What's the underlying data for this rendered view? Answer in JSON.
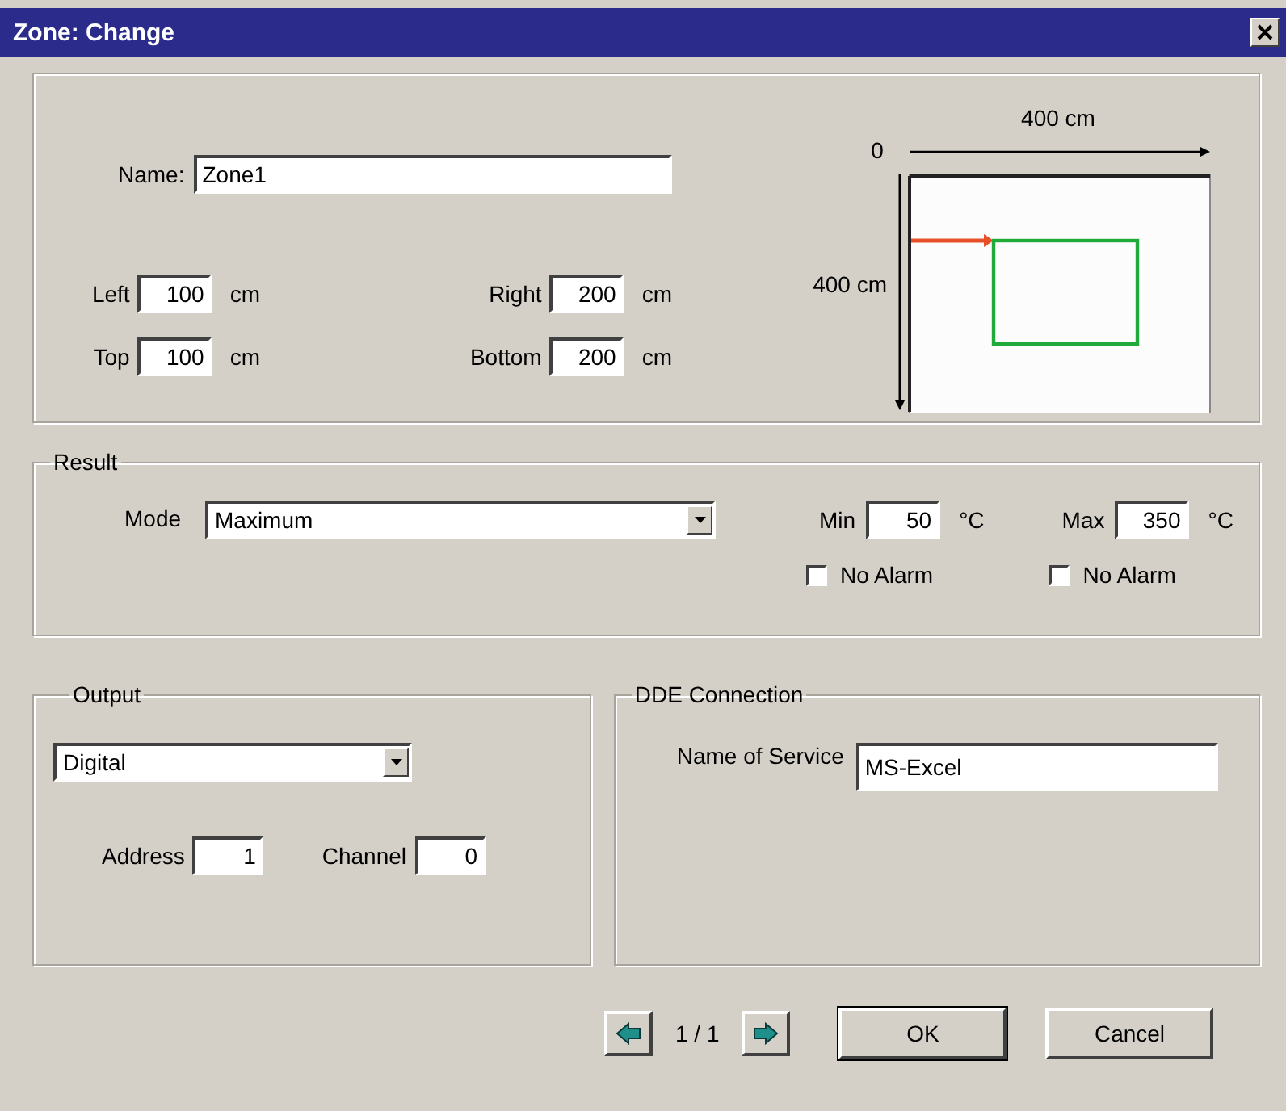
{
  "window": {
    "title": "Zone: Change"
  },
  "zone": {
    "name_label": "Name:",
    "name": "Zone1",
    "fields": [
      {
        "label": "Left",
        "value": "100",
        "unit": "cm"
      },
      {
        "label": "Right",
        "value": "200",
        "unit": "cm"
      },
      {
        "label": "Top",
        "value": "100",
        "unit": "cm"
      },
      {
        "label": "Bottom",
        "value": "200",
        "unit": "cm"
      }
    ]
  },
  "preview": {
    "origin": "0",
    "width_label": "400 cm",
    "height_label": "400 cm"
  },
  "result": {
    "title": "Result",
    "mode_label": "Mode",
    "mode": "Maximum",
    "limits": [
      {
        "label": "Min",
        "value": "50",
        "unit": "°C",
        "alarm_label": "No Alarm",
        "checked": false
      },
      {
        "label": "Max",
        "value": "350",
        "unit": "°C",
        "alarm_label": "No Alarm",
        "checked": false
      }
    ]
  },
  "output": {
    "title": "Output",
    "type": "Digital",
    "fields": [
      {
        "label": "Address",
        "value": "1"
      },
      {
        "label": "Channel",
        "value": "0"
      }
    ]
  },
  "dde": {
    "title": "DDE Connection",
    "service_label": "Name of Service",
    "service": "MS-Excel"
  },
  "footer": {
    "page": "1 / 1",
    "buttons": [
      {
        "label": "OK",
        "default": true
      },
      {
        "label": "Cancel",
        "default": false
      }
    ]
  }
}
